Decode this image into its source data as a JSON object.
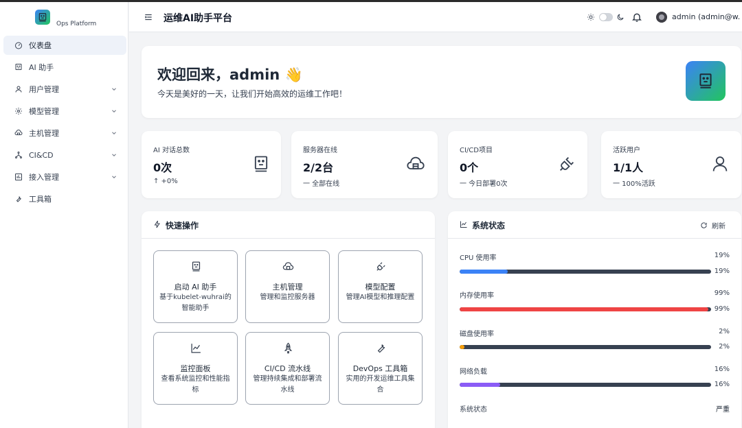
{
  "sidebar": {
    "logo_text": "Ops Platform",
    "items": [
      {
        "label": "仪表盘",
        "icon": "dashboard-icon"
      },
      {
        "label": "AI 助手",
        "icon": "ai-assistant-icon"
      },
      {
        "label": "用户管理",
        "icon": "user-icon"
      },
      {
        "label": "模型管理",
        "icon": "gear-icon"
      },
      {
        "label": "主机管理",
        "icon": "cloud-server-icon"
      },
      {
        "label": "CI&CD",
        "icon": "pipeline-icon"
      },
      {
        "label": "接入管理",
        "icon": "access-icon"
      },
      {
        "label": "工具箱",
        "icon": "wrench-icon"
      }
    ]
  },
  "header": {
    "title": "运维AI助手平台",
    "user": "admin (admin@w..."
  },
  "welcome": {
    "title": "欢迎回来，admin 👋",
    "subtitle": "今天是美好的一天，让我们开始高效的运维工作吧！"
  },
  "stats": [
    {
      "label": "AI 对话总数",
      "value": "0次",
      "foot": "↑ +0%"
    },
    {
      "label": "服务器在线",
      "value": "2/2台",
      "foot": "一 全部在线"
    },
    {
      "label": "CI/CD项目",
      "value": "0个",
      "foot": "一 今日部署0次"
    },
    {
      "label": "活跃用户",
      "value": "1/1人",
      "foot": "一 100%活跃"
    }
  ],
  "quick_actions": {
    "title": "快速操作",
    "tiles": [
      {
        "title": "启动 AI 助手",
        "desc": "基于kubelet-wuhrai的智能助手"
      },
      {
        "title": "主机管理",
        "desc": "管理和监控服务器"
      },
      {
        "title": "模型配置",
        "desc": "管理AI模型和推理配置"
      },
      {
        "title": "监控面板",
        "desc": "查看系统监控和性能指标"
      },
      {
        "title": "CI/CD 流水线",
        "desc": "管理持续集成和部署流水线"
      },
      {
        "title": "DevOps 工具箱",
        "desc": "实用的开发运维工具集合"
      }
    ]
  },
  "system_status": {
    "title": "系统状态",
    "refresh_label": "刷新",
    "metrics": [
      {
        "label": "CPU 使用率",
        "value": "19%",
        "percent": 19,
        "color": "#3b82f6"
      },
      {
        "label": "内存使用率",
        "value": "99%",
        "percent": 99,
        "color": "#ef4444"
      },
      {
        "label": "磁盘使用率",
        "value": "2%",
        "percent": 2,
        "color": "#f59e0b"
      },
      {
        "label": "网络负载",
        "value": "16%",
        "percent": 16,
        "color": "#8b5cf6"
      }
    ],
    "overall_label": "系统状态",
    "overall_value": "严重"
  }
}
